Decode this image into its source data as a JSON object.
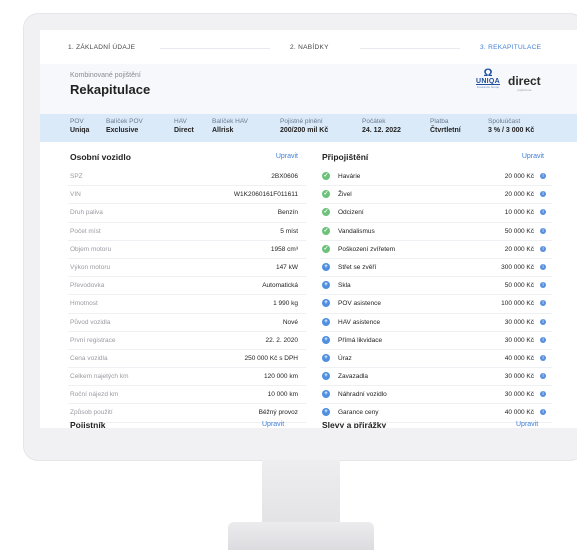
{
  "steps": [
    "1. ZÁKLADNÍ ÚDAJE",
    "2. NABÍDKY",
    "3. REKAPITULACE"
  ],
  "header": {
    "subtitle": "Kombinované pojištění",
    "title": "Rekapitulace"
  },
  "logos": {
    "uniqa": "UNIQA",
    "uniqa_tag": "Insurance Group",
    "direct": "direct",
    "direct_tag": "pojišťovna"
  },
  "summary": [
    {
      "label": "POV",
      "value": "Uniqa"
    },
    {
      "label": "Balíček POV",
      "value": "Exclusive"
    },
    {
      "label": "HAV",
      "value": "Direct"
    },
    {
      "label": "Balíček HAV",
      "value": "Allrisk"
    },
    {
      "label": "Pojistné plnění",
      "value": "200/200 mil Kč"
    },
    {
      "label": "Počátek",
      "value": "24. 12. 2022"
    },
    {
      "label": "Platba",
      "value": "Čtvrtletní"
    },
    {
      "label": "Spoluúčast",
      "value": "3 % / 3 000 Kč"
    }
  ],
  "vehicle": {
    "title": "Osobní vozidlo",
    "edit": "Upravit",
    "rows": [
      {
        "k": "SPZ",
        "v": "2BX0606"
      },
      {
        "k": "VIN",
        "v": "W1K2060161F011611"
      },
      {
        "k": "Druh paliva",
        "v": "Benzín"
      },
      {
        "k": "Počet míst",
        "v": "5 míst"
      },
      {
        "k": "Objem motoru",
        "v": "1958 cm³"
      },
      {
        "k": "Výkon motoru",
        "v": "147 kW"
      },
      {
        "k": "Převodovka",
        "v": "Automatická"
      },
      {
        "k": "Hmotnost",
        "v": "1 990 kg"
      },
      {
        "k": "Původ vozidla",
        "v": "Nové"
      },
      {
        "k": "První registrace",
        "v": "22. 2. 2020"
      },
      {
        "k": "Cena vozidla",
        "v": "250 000 Kč s DPH"
      },
      {
        "k": "Celkem najetých km",
        "v": "120 000 km"
      },
      {
        "k": "Roční nájezd km",
        "v": "10 000 km"
      },
      {
        "k": "Způsob použití",
        "v": "Běžný provoz"
      }
    ]
  },
  "addons": {
    "title": "Připojištění",
    "edit": "Upravit",
    "rows": [
      {
        "k": "Havárie",
        "v": "20 000 Kč",
        "icon": "check-icon"
      },
      {
        "k": "Živel",
        "v": "20 000 Kč",
        "icon": "check-icon"
      },
      {
        "k": "Odcizení",
        "v": "10 000 Kč",
        "icon": "check-icon"
      },
      {
        "k": "Vandalismus",
        "v": "50 000 Kč",
        "icon": "check-icon"
      },
      {
        "k": "Poškození zvířetem",
        "v": "20 000 Kč",
        "icon": "check-icon"
      },
      {
        "k": "Střet se zvěří",
        "v": "300 000 Kč",
        "icon": "plus-icon"
      },
      {
        "k": "Skla",
        "v": "50 000 Kč",
        "icon": "plus-icon"
      },
      {
        "k": "POV asistence",
        "v": "100 000 Kč",
        "icon": "plus-icon"
      },
      {
        "k": "HAV asistence",
        "v": "30 000 Kč",
        "icon": "plus-icon"
      },
      {
        "k": "Přímá likvidace",
        "v": "30 000 Kč",
        "icon": "plus-icon"
      },
      {
        "k": "Úraz",
        "v": "40 000 Kč",
        "icon": "plus-icon"
      },
      {
        "k": "Zavazadla",
        "v": "30 000 Kč",
        "icon": "plus-icon"
      },
      {
        "k": "Náhradní vozidlo",
        "v": "30 000 Kč",
        "icon": "plus-icon"
      },
      {
        "k": "Garance ceny",
        "v": "40 000 Kč",
        "icon": "plus-icon"
      }
    ]
  },
  "bottom": {
    "left_title": "Pojistník",
    "left_edit": "Upravit",
    "right_title": "Slevy a přirážky",
    "right_edit": "Upravit"
  },
  "colors": {
    "accent": "#3e7fd8",
    "summary_bg": "#dbeaf8",
    "check": "#6cc27a",
    "plus": "#4f8fe0"
  }
}
